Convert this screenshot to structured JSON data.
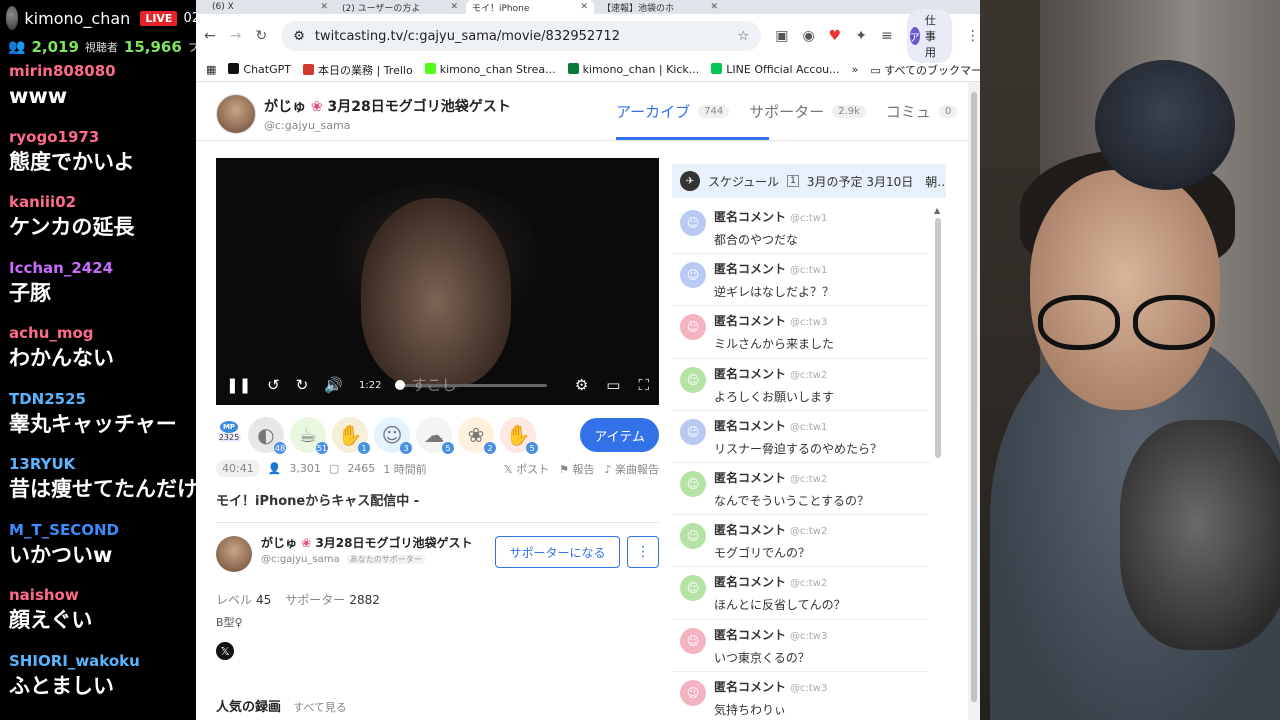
{
  "stream_chat": {
    "channel": "kimono_chan",
    "live_badge": "LIVE",
    "extra": "02",
    "viewers_value": "2,019",
    "viewers_label": "視聴者",
    "followers_value": "15,966",
    "followers_label": "フ",
    "messages": [
      {
        "user": "mirin808080",
        "text": "www",
        "color": "#ff6b8a"
      },
      {
        "user": "ryogo1973",
        "text": "態度でかいよ",
        "color": "#ff6b8a"
      },
      {
        "user": "kaniii02",
        "text": "ケンカの延長",
        "color": "#ff6b8a"
      },
      {
        "user": "Icchan_2424",
        "text": "子豚",
        "color": "#c86bff"
      },
      {
        "user": "achu_mog",
        "text": "わかんない",
        "color": "#ff6b8a"
      },
      {
        "user": "TDN2525",
        "text": "睾丸キャッチャー",
        "color": "#5ab4ff"
      },
      {
        "user": "13RYUK",
        "text": "昔は痩せてたんだけ",
        "color": "#5ab4ff"
      },
      {
        "user": "M_T_SECOND",
        "text": "いかついw",
        "color": "#3c8cff"
      },
      {
        "user": "naishow",
        "text": "顔えぐい",
        "color": "#ff6b8a"
      },
      {
        "user": "SHIORI_wakoku",
        "text": "ふとましい",
        "color": "#5ab4ff"
      }
    ]
  },
  "browser": {
    "tabs": [
      {
        "title": "(6) X",
        "active": false
      },
      {
        "title": "(2) ユーザーの方よ",
        "active": false
      },
      {
        "title": "モイ！iPhone",
        "active": true
      },
      {
        "title": "【速報】池袋のホ",
        "active": false
      }
    ],
    "url": "twitcasting.tv/c:gajyu_sama/movie/832952712",
    "profile_label": "仕事用",
    "profile_initial": "ア",
    "bookmarks": [
      {
        "label": "ChatGPT",
        "color": "#111"
      },
      {
        "label": "本日の業務 | Trello",
        "color": "#d0392b"
      },
      {
        "label": "kimono_chan Strea...",
        "color": "#53fc18"
      },
      {
        "label": "kimono_chan | Kick...",
        "color": "#0a7a3b"
      },
      {
        "label": "LINE Official Accou...",
        "color": "#06c755"
      }
    ],
    "bookmarks_folder": "すべてのブックマーク"
  },
  "channel": {
    "name": "がじゅ",
    "title_suffix": "3月28日モグゴリ池袋ゲスト",
    "id": "@c:gajyu_sama",
    "tabs": [
      {
        "label": "アーカイブ",
        "count": "744",
        "active": true
      },
      {
        "label": "サポーター",
        "count": "2.9k",
        "active": false
      },
      {
        "label": "コミュ",
        "count": "0",
        "active": false
      }
    ]
  },
  "player": {
    "time": "1:22",
    "seek_label": "すこし",
    "progress": 0.02
  },
  "items": {
    "mp_label": "MP",
    "mp_value": "2325",
    "list": [
      {
        "icon": "stone-icon",
        "glyph": "◐",
        "count": "48",
        "bg": "#e7e7e7"
      },
      {
        "icon": "tea-icon",
        "glyph": "☕",
        "count": "51",
        "bg": "#eaf7e0"
      },
      {
        "icon": "hand-icon",
        "glyph": "✋",
        "count": "1",
        "bg": "#f6efd7"
      },
      {
        "icon": "ghost-icon",
        "glyph": "☺",
        "count": "3",
        "bg": "#e3f3ff"
      },
      {
        "icon": "cloud-icon",
        "glyph": "☁",
        "count": "5",
        "bg": "#f4f4f4"
      },
      {
        "icon": "food-icon",
        "glyph": "❀",
        "count": "2",
        "bg": "#fff1dd"
      },
      {
        "icon": "clap-icon",
        "glyph": "✋",
        "count": "5",
        "bg": "#fde8e2"
      }
    ],
    "button": "アイテム"
  },
  "meta": {
    "duration": "40:41",
    "total_views": "3,301",
    "comments": "2465",
    "ago": "1 時間前",
    "post": "ポスト",
    "report": "報告",
    "music_report": "楽曲報告"
  },
  "movie_title": "モイ！iPhoneからキャス配信中 -",
  "profile": {
    "name": "がじゅ",
    "title_suffix": "3月28日モグゴリ池袋ゲスト",
    "id": "@c:gajyu_sama",
    "tag": "あなたのサポーター",
    "supporter_button": "サポーターになる",
    "level_label": "レベル",
    "level_value": "45",
    "supporter_label": "サポーター",
    "supporter_value": "2882",
    "bio": "B型♀"
  },
  "popular": {
    "heading": "人気の録画",
    "link": "すべて見る"
  },
  "schedule": {
    "text": "スケジュール",
    "num": "1",
    "detail": "3月の予定 3月10日　朝…"
  },
  "comments": [
    {
      "name": "匿名コメント",
      "id": "@c:tw1",
      "text": "都合のやつだな",
      "color": "#b9c9f3"
    },
    {
      "name": "匿名コメント",
      "id": "@c:tw1",
      "text": "逆ギレはなしだよ？？",
      "color": "#b9c9f3"
    },
    {
      "name": "匿名コメント",
      "id": "@c:tw3",
      "text": "ミルさんから来ました",
      "color": "#f4b3c1"
    },
    {
      "name": "匿名コメント",
      "id": "@c:tw2",
      "text": "よろしくお願いします",
      "color": "#b5e2a5"
    },
    {
      "name": "匿名コメント",
      "id": "@c:tw1",
      "text": "リスナー脅迫するのやめたら？",
      "color": "#b9c9f3"
    },
    {
      "name": "匿名コメント",
      "id": "@c:tw2",
      "text": "なんでそういうことするの？",
      "color": "#b5e2a5"
    },
    {
      "name": "匿名コメント",
      "id": "@c:tw2",
      "text": "モグゴリでんの？",
      "color": "#b5e2a5"
    },
    {
      "name": "匿名コメント",
      "id": "@c:tw2",
      "text": "ほんとに反省してんの？",
      "color": "#b5e2a5"
    },
    {
      "name": "匿名コメント",
      "id": "@c:tw3",
      "text": "いつ東京くるの？",
      "color": "#f4b3c1"
    },
    {
      "name": "匿名コメント",
      "id": "@c:tw3",
      "text": "気持ちわりぃ",
      "color": "#f4b3c1"
    }
  ]
}
